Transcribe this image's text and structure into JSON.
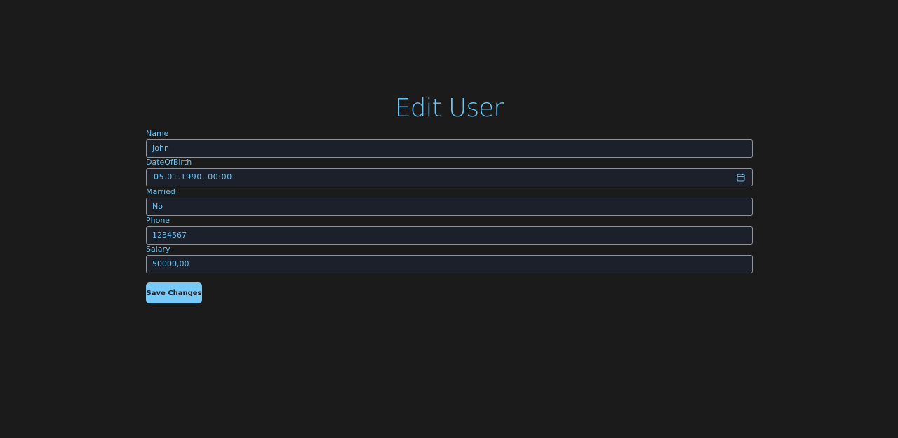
{
  "page": {
    "title": "Edit User"
  },
  "form": {
    "fields": [
      {
        "label": "Name",
        "value": "John"
      },
      {
        "label": "DateOfBirth",
        "value": "05.01.1990, 00:00"
      },
      {
        "label": "Married",
        "value": "No"
      },
      {
        "label": "Phone",
        "value": "1234567"
      },
      {
        "label": "Salary",
        "value": "50000,00"
      }
    ],
    "submit_label": "Save Changes"
  },
  "icons": {
    "date_picker": "calendar-icon"
  },
  "colors": {
    "background": "#1b1b1b",
    "accent": "#6cc3f5",
    "input_background": "#1c202a",
    "input_border": "#8f949b",
    "button_background": "#77c9f7",
    "button_text": "#1a1f2a"
  }
}
